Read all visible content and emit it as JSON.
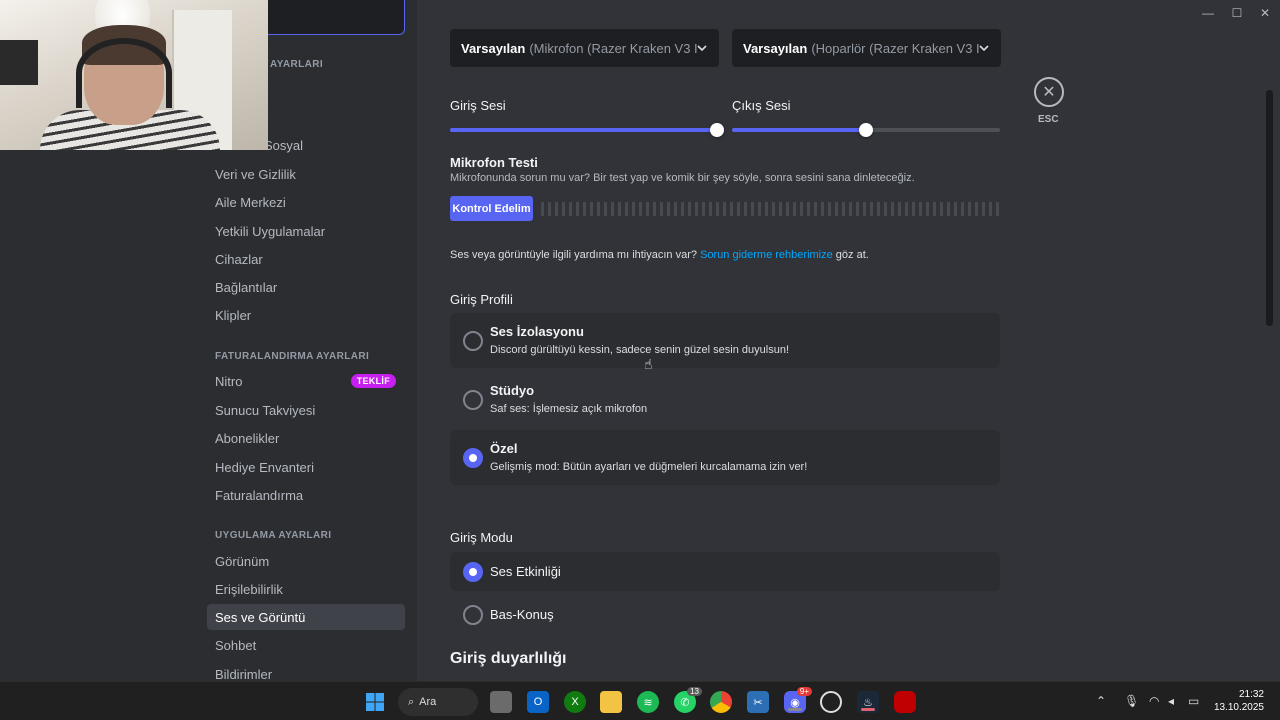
{
  "window": {
    "minimize": "—",
    "maximize": "☐",
    "close": "✕"
  },
  "sidebar": {
    "items_top": [
      {
        "label": "Sosyal"
      },
      {
        "label": "Veri ve Gizlilik"
      },
      {
        "label": "Aile Merkezi"
      },
      {
        "label": "Yetkili Uygulamalar"
      },
      {
        "label": "Cihazlar"
      },
      {
        "label": "Bağlantılar"
      },
      {
        "label": "Klipler"
      }
    ],
    "header_partial": "AYARLARI",
    "billing_header": "FATURALANDIRMA AYARLARI",
    "billing_items": [
      {
        "label": "Nitro",
        "badge": "TEKLİF"
      },
      {
        "label": "Sunucu Takviyesi"
      },
      {
        "label": "Abonelikler"
      },
      {
        "label": "Hediye Envanteri"
      },
      {
        "label": "Faturalandırma"
      }
    ],
    "app_header": "UYGULAMA AYARLARI",
    "app_items": [
      {
        "label": "Görünüm"
      },
      {
        "label": "Erişilebilirlik"
      },
      {
        "label": "Ses ve Görüntü",
        "selected": true
      },
      {
        "label": "Sohbet"
      },
      {
        "label": "Bildirimler"
      }
    ]
  },
  "voice": {
    "input_device": {
      "selected": "Varsayılan",
      "device": "(Mikrofon (Razer Kraken V3 I"
    },
    "output_device": {
      "selected": "Varsayılan",
      "device": "(Hoparlör (Razer Kraken V3 I"
    },
    "input_volume_label": "Giriş Sesi",
    "output_volume_label": "Çıkış Sesi",
    "input_volume": 1.0,
    "output_volume": 0.5,
    "mic_test_title": "Mikrofon Testi",
    "mic_test_desc": "Mikrofonunda sorun mu var? Bir test yap ve komik bir şey söyle, sonra sesini sana dinleteceğiz.",
    "mic_test_button": "Kontrol Edelim",
    "help_prefix": "Ses veya görüntüyle ilgili yardıma mı ihtiyacın var?",
    "help_link": "Sorun giderme rehberimize",
    "help_suffix": "göz at.",
    "input_profile_title": "Giriş Profili",
    "profiles": [
      {
        "title": "Ses İzolasyonu",
        "desc": "Discord gürültüyü kessin, sadece senin güzel sesin duyulsun!",
        "selected": false
      },
      {
        "title": "Stüdyo",
        "desc": "Saf ses: İşlemesiz açık mikrofon",
        "selected": false
      },
      {
        "title": "Özel",
        "desc": "Gelişmiş mod: Bütün ayarları ve düğmeleri kurcalamama izin ver!",
        "selected": true
      }
    ],
    "input_mode_title": "Giriş Modu",
    "modes": [
      {
        "title": "Ses Etkinliği",
        "selected": true
      },
      {
        "title": "Bas-Konuş",
        "selected": false
      }
    ],
    "sensitivity_title": "Giriş duyarlılığı"
  },
  "close_button": {
    "label": "ESC",
    "glyph": "✕"
  },
  "taskbar": {
    "search_label": "Ara",
    "whatsapp_badge": "13",
    "discord_badge": "9+",
    "time": "21:32",
    "date": "13.10.2025"
  },
  "colors": {
    "accent": "#5865f2",
    "link": "#00a8fc",
    "badge": "#c71ff0"
  }
}
